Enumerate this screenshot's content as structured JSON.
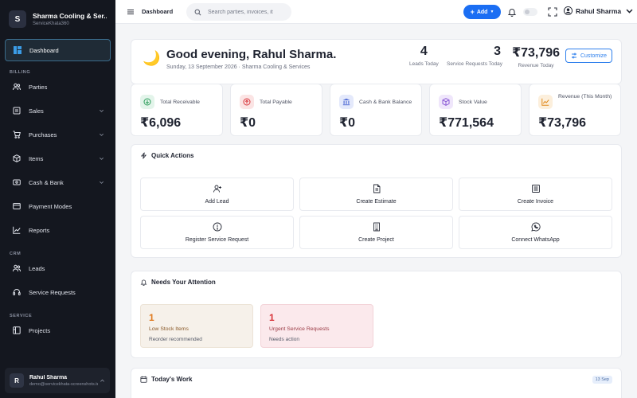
{
  "sidebar": {
    "brand_logo": "S",
    "brand_name": "Sharma Cooling & Ser...",
    "brand_sub": "ServiceKhata360",
    "dashboard": "Dashboard",
    "sections": {
      "billing": "BILLING",
      "crm": "CRM",
      "service": "SERVICE"
    },
    "items": {
      "parties": "Parties",
      "sales": "Sales",
      "purchases": "Purchases",
      "items": "Items",
      "cash_bank": "Cash & Bank",
      "payment_modes": "Payment Modes",
      "reports": "Reports",
      "leads": "Leads",
      "service_requests": "Service Requests",
      "projects": "Projects"
    },
    "user": {
      "initial": "R",
      "name": "Rahul Sharma",
      "email": "demo@servicekhata-screenshots.test"
    }
  },
  "topbar": {
    "breadcrumb": "Dashboard",
    "search_placeholder": "Search parties, invoices, it",
    "add_label": "Add",
    "user_name": "Rahul Sharma"
  },
  "greeting": {
    "title": "Good evening, Rahul Sharma.",
    "subtitle": "Sunday, 13 September 2026 · Sharma Cooling & Services",
    "stats": {
      "leads": {
        "value": "4",
        "label": "Leads Today"
      },
      "service": {
        "value": "3",
        "label": "Service Requests Today"
      },
      "revenue": {
        "value": "₹73,796",
        "label": "Revenue Today"
      }
    },
    "customize_label": "Customize"
  },
  "kpis": {
    "receivable": {
      "label": "Total Receivable",
      "value": "₹6,096"
    },
    "payable": {
      "label": "Total Payable",
      "value": "₹0"
    },
    "cash_bank": {
      "label": "Cash & Bank Balance",
      "value": "₹0"
    },
    "stock": {
      "label": "Stock Value",
      "value": "₹771,564"
    },
    "revenue": {
      "label": "Revenue (This Month)",
      "value": "₹73,796"
    }
  },
  "quick_actions": {
    "title": "Quick Actions",
    "add_lead": "Add Lead",
    "create_estimate": "Create Estimate",
    "create_invoice": "Create Invoice",
    "register_service": "Register Service Request",
    "create_project": "Create Project",
    "connect_whatsapp": "Connect WhatsApp"
  },
  "attention": {
    "title": "Needs Your Attention",
    "low_stock": {
      "count": "1",
      "title": "Low Stock Items",
      "sub": "Reorder recommended"
    },
    "urgent": {
      "count": "1",
      "title": "Urgent Service Requests",
      "sub": "Needs action"
    }
  },
  "todays_work": {
    "title": "Today's Work",
    "date": "13 Sep"
  },
  "colors": {
    "primary": "#1b6ef3",
    "sidebar_bg": "#14171f",
    "low_stock_accent": "#e07a1f",
    "urgent_accent": "#d8343a"
  }
}
